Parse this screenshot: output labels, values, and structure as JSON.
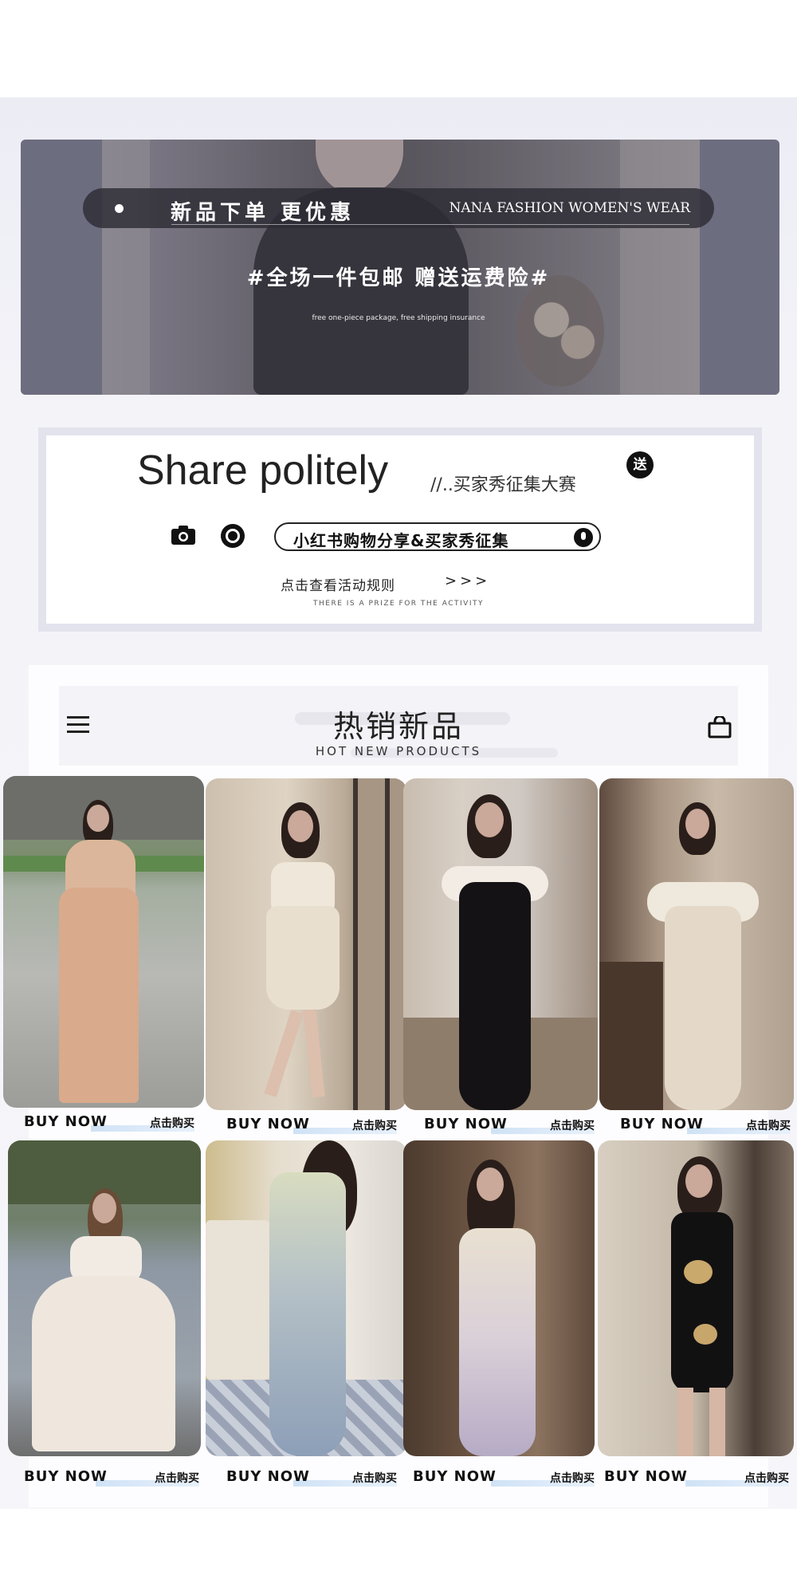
{
  "banner": {
    "headline": "新品下单 更优惠",
    "brand": "NANA FASHION WOMEN'S WEAR",
    "promo": "#全场一件包邮 赠送运费险#",
    "promo_en": "free one-piece package, free shipping insurance"
  },
  "share": {
    "title": "Share politely",
    "subtitle": "//..买家秀征集大赛",
    "badge": "送",
    "pill": "小红书购物分享&买家秀征集",
    "rules": "点击查看活动规则",
    "arrows": ">>>",
    "prize": "THERE IS A PRIZE FOR THE ACTIVITY"
  },
  "section": {
    "title": "热销新品",
    "subtitle": "HOT NEW PRODUCTS"
  },
  "products": [
    {
      "buy": "BUY NOW",
      "cn": "点击购买"
    },
    {
      "buy": "BUY NOW",
      "cn": "点击购买"
    },
    {
      "buy": "BUY NOW",
      "cn": "点击购买"
    },
    {
      "buy": "BUY NOW",
      "cn": "点击购买"
    },
    {
      "buy": "BUY NOW",
      "cn": "点击购买"
    },
    {
      "buy": "BUY NOW",
      "cn": "点击购买"
    },
    {
      "buy": "BUY NOW",
      "cn": "点击购买"
    },
    {
      "buy": "BUY NOW",
      "cn": "点击购买"
    }
  ],
  "colors": {
    "banner_bg": "#6d6e80",
    "accent_underline": "#cfe2f6",
    "text_dark": "#222222"
  }
}
